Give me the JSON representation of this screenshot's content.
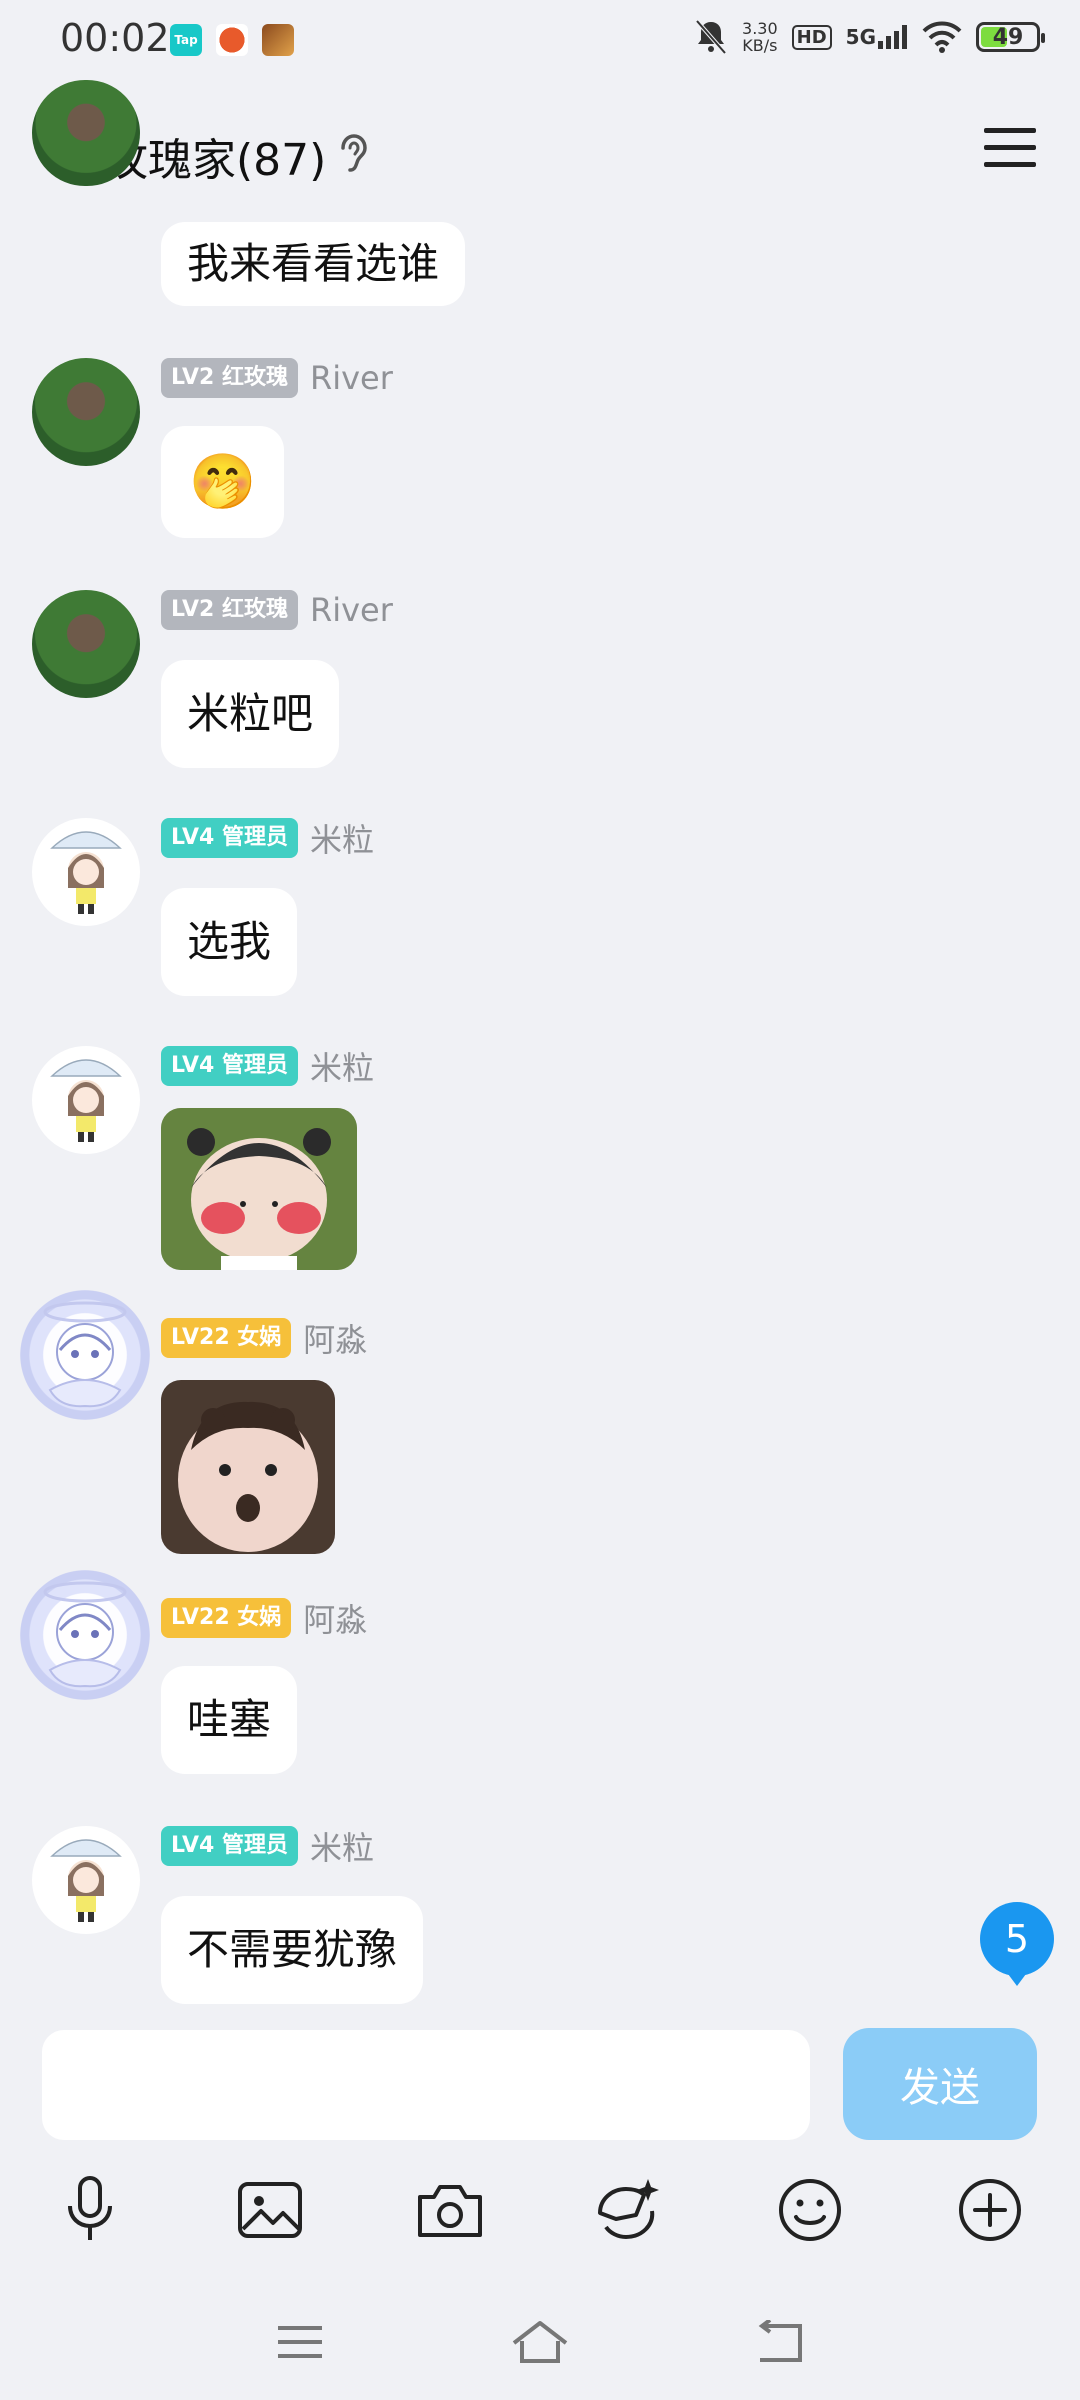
{
  "status_bar": {
    "time": "00:02",
    "apps": [
      {
        "name": "taptap-icon",
        "color": "#18c8c8",
        "text": "Tap"
      },
      {
        "name": "game-icon-red",
        "color": "#e85a2b"
      },
      {
        "name": "game-icon-brown",
        "color": "#8b4a1e"
      }
    ],
    "net_speed_value": "3.30",
    "net_speed_unit": "KB/s",
    "hd": "HD",
    "network": "5G",
    "battery": "49",
    "battery_level": 0.49
  },
  "header": {
    "title": "玫瑰家(87)"
  },
  "messages": [
    {
      "type": "text",
      "text": "我来看看选谁"
    },
    {
      "type": "emoji",
      "badge": "LV2 红玫瑰",
      "badge_color": "gray",
      "name": "River",
      "emoji": "🤭"
    },
    {
      "type": "text",
      "badge": "LV2 红玫瑰",
      "badge_color": "gray",
      "name": "River",
      "text": "米粒吧"
    },
    {
      "type": "text",
      "badge": "LV4 管理员",
      "badge_color": "teal",
      "name": "米粒",
      "text": "选我"
    },
    {
      "type": "image",
      "badge": "LV4 管理员",
      "badge_color": "teal",
      "name": "米粒"
    },
    {
      "type": "image",
      "badge": "LV22 女娲",
      "badge_color": "gold",
      "name": "阿淼"
    },
    {
      "type": "text",
      "badge": "LV22 女娲",
      "badge_color": "gold",
      "name": "阿淼",
      "text": "哇塞"
    },
    {
      "type": "text",
      "badge": "LV4 管理员",
      "badge_color": "teal",
      "name": "米粒",
      "text": "不需要犹豫"
    }
  ],
  "unread_count": "5",
  "composer": {
    "input_value": "",
    "send_label": "发送"
  },
  "toolbar": [
    "mic-icon",
    "image-icon",
    "camera-icon",
    "sticker-icon",
    "emoji-icon",
    "plus-icon"
  ],
  "nav": [
    "menu-icon",
    "home-icon",
    "back-icon"
  ]
}
